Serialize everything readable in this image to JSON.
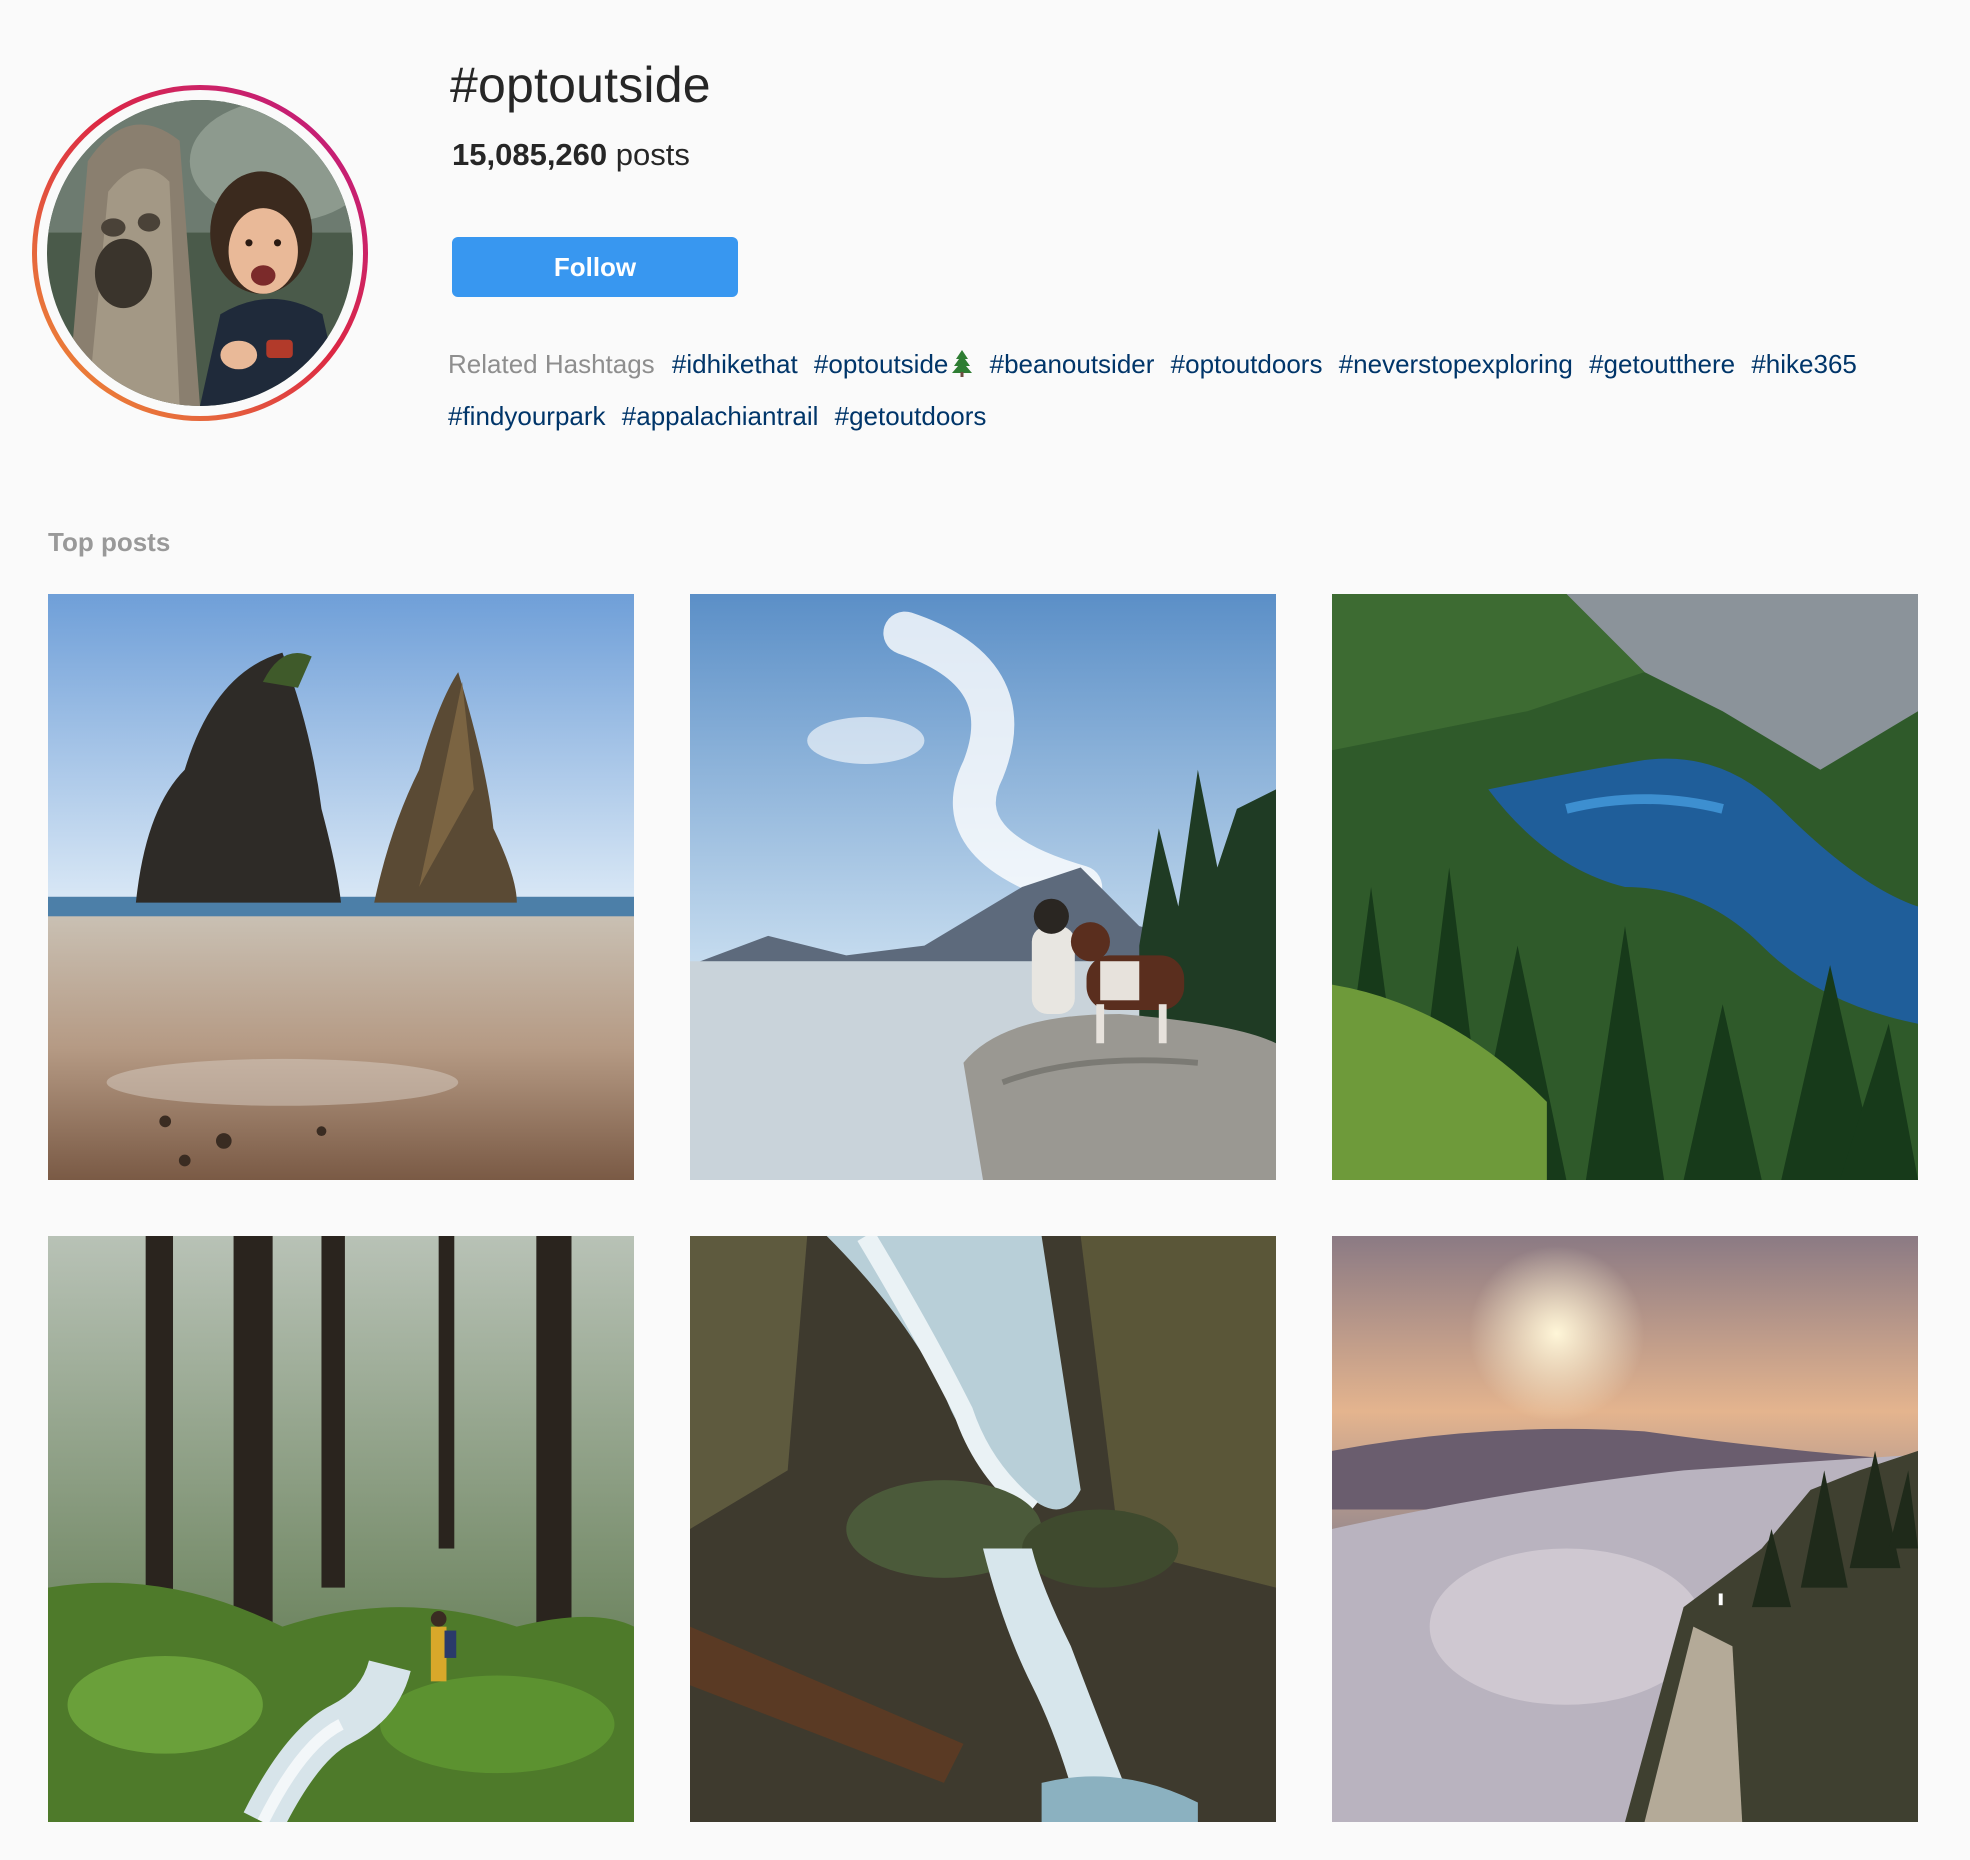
{
  "header": {
    "hashtag": "#optoutside",
    "post_count": "15,085,260",
    "post_count_suffix": " posts",
    "follow_label": "Follow",
    "related_label": "Related Hashtags",
    "related_tags": [
      "#idhikethat",
      "#optoutside",
      "#beanoutsider",
      "#optoutdoors",
      "#neverstopexploring",
      "#getoutthere",
      "#hike365",
      "#findyourpark",
      "#appalachiantrail",
      "#getoutdoors"
    ]
  },
  "top_posts": {
    "title": "Top posts"
  },
  "colors": {
    "follow_button": "#3897f0",
    "tag_link": "#003569",
    "muted_text": "#8e8e8e",
    "background": "#fafafa"
  }
}
